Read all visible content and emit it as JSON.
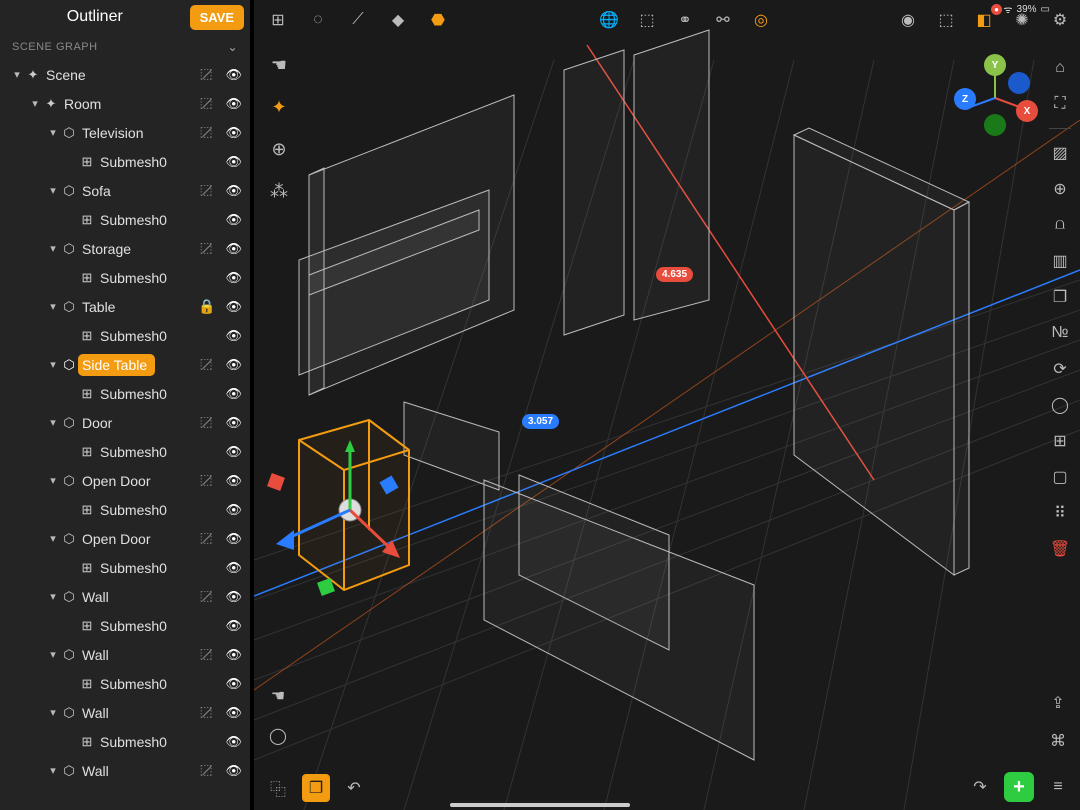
{
  "status": {
    "battery": "39%",
    "wifi": "􀙇"
  },
  "outliner": {
    "title": "Outliner",
    "save_label": "SAVE",
    "section_label": "SCENE GRAPH",
    "tree": [
      {
        "depth": 0,
        "disclosure": "▾",
        "icon": "axes",
        "label": "Scene",
        "hide": true,
        "eye": true
      },
      {
        "depth": 1,
        "disclosure": "▾",
        "icon": "axes",
        "label": "Room",
        "hide": true,
        "eye": true
      },
      {
        "depth": 2,
        "disclosure": "▾",
        "icon": "cube",
        "label": "Television",
        "hide": true,
        "eye": true
      },
      {
        "depth": 3,
        "disclosure": "",
        "icon": "mesh",
        "label": "Submesh0",
        "eye": true
      },
      {
        "depth": 2,
        "disclosure": "▾",
        "icon": "cube",
        "label": "Sofa",
        "hide": true,
        "eye": true
      },
      {
        "depth": 3,
        "disclosure": "",
        "icon": "mesh",
        "label": "Submesh0",
        "eye": true
      },
      {
        "depth": 2,
        "disclosure": "▾",
        "icon": "cube",
        "label": "Storage",
        "hide": true,
        "eye": true
      },
      {
        "depth": 3,
        "disclosure": "",
        "icon": "mesh",
        "label": "Submesh0",
        "eye": true
      },
      {
        "depth": 2,
        "disclosure": "▾",
        "icon": "cube",
        "label": "Table",
        "lock": true,
        "eye": true
      },
      {
        "depth": 3,
        "disclosure": "",
        "icon": "mesh",
        "label": "Submesh0",
        "eye": true
      },
      {
        "depth": 2,
        "disclosure": "▾",
        "icon": "cube",
        "label": "Side Table",
        "selected": true,
        "hide": true,
        "eye": true
      },
      {
        "depth": 3,
        "disclosure": "",
        "icon": "mesh",
        "label": "Submesh0",
        "eye": true
      },
      {
        "depth": 2,
        "disclosure": "▾",
        "icon": "cube",
        "label": "Door",
        "hide": true,
        "eye": true
      },
      {
        "depth": 3,
        "disclosure": "",
        "icon": "mesh",
        "label": "Submesh0",
        "eye": true
      },
      {
        "depth": 2,
        "disclosure": "▾",
        "icon": "cube",
        "label": "Open Door",
        "hide": true,
        "eye": true
      },
      {
        "depth": 3,
        "disclosure": "",
        "icon": "mesh",
        "label": "Submesh0",
        "eye": true
      },
      {
        "depth": 2,
        "disclosure": "▾",
        "icon": "cube",
        "label": "Open Door",
        "hide": true,
        "eye": true
      },
      {
        "depth": 3,
        "disclosure": "",
        "icon": "mesh",
        "label": "Submesh0",
        "eye": true
      },
      {
        "depth": 2,
        "disclosure": "▾",
        "icon": "cube",
        "label": "Wall",
        "hide": true,
        "eye": true
      },
      {
        "depth": 3,
        "disclosure": "",
        "icon": "mesh",
        "label": "Submesh0",
        "eye": true
      },
      {
        "depth": 2,
        "disclosure": "▾",
        "icon": "cube",
        "label": "Wall",
        "hide": true,
        "eye": true
      },
      {
        "depth": 3,
        "disclosure": "",
        "icon": "mesh",
        "label": "Submesh0",
        "eye": true
      },
      {
        "depth": 2,
        "disclosure": "▾",
        "icon": "cube",
        "label": "Wall",
        "hide": true,
        "eye": true
      },
      {
        "depth": 3,
        "disclosure": "",
        "icon": "mesh",
        "label": "Submesh0",
        "eye": true
      },
      {
        "depth": 2,
        "disclosure": "▾",
        "icon": "cube",
        "label": "Wall",
        "hide": true,
        "eye": true
      }
    ]
  },
  "top_tools": {
    "left": [
      {
        "name": "grid-4-icon",
        "glyph": "⊞"
      },
      {
        "name": "wireframe-sphere-icon",
        "glyph": "◌"
      },
      {
        "name": "edge-split-icon",
        "glyph": "⟋"
      },
      {
        "name": "solid-layer-icon",
        "glyph": "◆"
      },
      {
        "name": "solid-hex-icon",
        "glyph": "⬣",
        "active": true
      }
    ],
    "mid": [
      {
        "name": "world-icon",
        "glyph": "🌐",
        "active": true
      },
      {
        "name": "cube-outline-icon",
        "glyph": "⬚"
      },
      {
        "name": "link-icon",
        "glyph": "⚭"
      },
      {
        "name": "camera-link-icon",
        "glyph": "⚯"
      },
      {
        "name": "target-icon",
        "glyph": "◎",
        "active": true
      }
    ],
    "right": [
      {
        "name": "cube-solid-icon",
        "glyph": "◉"
      },
      {
        "name": "cube-wire-icon",
        "glyph": "⬚"
      },
      {
        "name": "cube-orange-icon",
        "glyph": "◧",
        "active": true,
        "badge": "●"
      },
      {
        "name": "sun-icon",
        "glyph": "✺"
      },
      {
        "name": "gear-icon",
        "glyph": "⚙"
      }
    ]
  },
  "left_strip": [
    {
      "name": "hand-icon",
      "glyph": "☚"
    },
    {
      "name": "move-gizmo-icon",
      "glyph": "✦",
      "active": true
    },
    {
      "name": "globe-icon",
      "glyph": "⊕"
    },
    {
      "name": "pivot-icon",
      "glyph": "⁂"
    }
  ],
  "left_strip2": [
    {
      "name": "pointer-icon",
      "glyph": "☚"
    },
    {
      "name": "lasso-icon",
      "glyph": "◯"
    }
  ],
  "right_strip": [
    {
      "name": "home-icon",
      "glyph": "⌂"
    },
    {
      "name": "focus-icon",
      "glyph": "⛶"
    },
    {
      "divider": true
    },
    {
      "name": "grid-toggle-icon",
      "glyph": "▨"
    },
    {
      "name": "snap-icon",
      "glyph": "⊕"
    },
    {
      "name": "mirror-icon",
      "glyph": "⩍"
    },
    {
      "name": "ruler-icon",
      "glyph": "▥"
    },
    {
      "name": "layers-icon",
      "glyph": "❐"
    },
    {
      "name": "number-icon",
      "glyph": "№"
    },
    {
      "name": "refresh-icon",
      "glyph": "⟳"
    },
    {
      "name": "circle-icon",
      "glyph": "◯"
    },
    {
      "name": "firstaid-icon",
      "glyph": "⊞"
    },
    {
      "name": "rect-icon",
      "glyph": "▢"
    },
    {
      "name": "marquee-icon",
      "glyph": "⠿"
    },
    {
      "name": "trash-icon",
      "glyph": "🗑",
      "cls": "trash"
    }
  ],
  "bottom_left": [
    {
      "name": "panel-layout-icon",
      "glyph": "⿻"
    },
    {
      "name": "duplicate-icon",
      "glyph": "❐",
      "cls": "ico-copy"
    },
    {
      "name": "undo-icon",
      "glyph": "↶"
    }
  ],
  "bottom_right_extra": [
    {
      "name": "share-icon",
      "glyph": "⇪"
    },
    {
      "name": "command-icon",
      "glyph": "⌘"
    }
  ],
  "bottom_right": [
    {
      "name": "redo-icon",
      "glyph": "↷"
    },
    {
      "name": "add-icon",
      "glyph": "+",
      "cls": "plus-btn"
    },
    {
      "name": "menu-icon",
      "glyph": "≡"
    }
  ],
  "gizmo_axes": {
    "x": "X",
    "y": "Y",
    "z": "Z"
  },
  "measurements": {
    "red": "4.635",
    "blue": "3.057"
  },
  "colors": {
    "accent": "#f39c12",
    "danger": "#e74c3c",
    "ok": "#2ecc40",
    "axis_x": "#e74c3c",
    "axis_y": "#2ecc40",
    "axis_z": "#2a7cff"
  }
}
